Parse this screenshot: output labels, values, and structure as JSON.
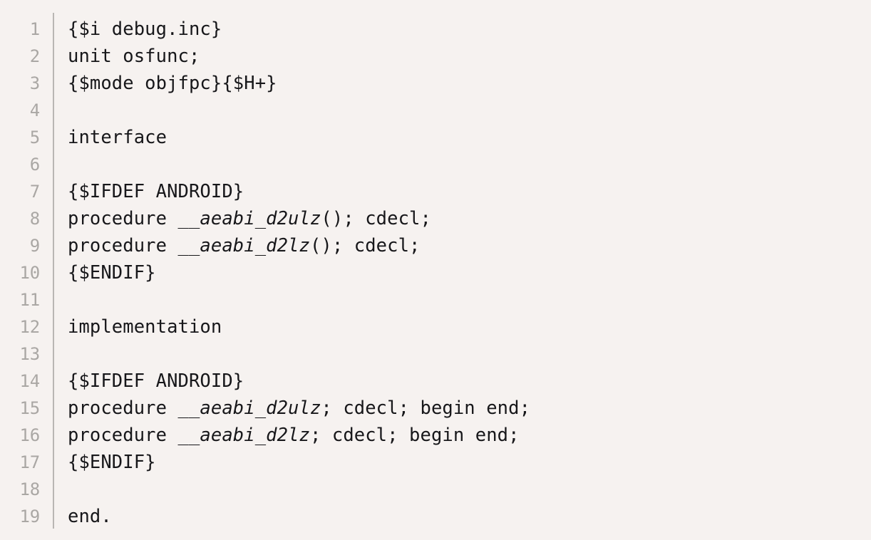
{
  "editor": {
    "name": "code-viewer",
    "language": "Pascal",
    "background_color": "#f6f2f0",
    "code_color": "#17171a",
    "line_number_color": "#aaa7a4",
    "divider_color": "#b9b6b3",
    "total_lines": 19
  },
  "lines": [
    {
      "number": "1",
      "text": "{$i debug.inc}",
      "tokens": [
        {
          "t": "{$i debug.inc}",
          "style": "plain"
        }
      ]
    },
    {
      "number": "2",
      "text": "unit osfunc;",
      "tokens": [
        {
          "t": "unit osfunc;",
          "style": "plain"
        }
      ]
    },
    {
      "number": "3",
      "text": "{$mode objfpc}{$H+}",
      "tokens": [
        {
          "t": "{$mode objfpc}{$H+}",
          "style": "plain"
        }
      ]
    },
    {
      "number": "4",
      "text": "",
      "tokens": []
    },
    {
      "number": "5",
      "text": "interface",
      "tokens": [
        {
          "t": "interface",
          "style": "plain"
        }
      ]
    },
    {
      "number": "6",
      "text": "",
      "tokens": []
    },
    {
      "number": "7",
      "text": "{$IFDEF ANDROID}",
      "tokens": [
        {
          "t": "{$IFDEF ANDROID}",
          "style": "plain"
        }
      ]
    },
    {
      "number": "8",
      "text": "procedure __aeabi_d2ulz(); cdecl;",
      "tokens": [
        {
          "t": "procedure ",
          "style": "plain"
        },
        {
          "t": "__aeabi_d2ulz",
          "style": "ident"
        },
        {
          "t": "(); cdecl;",
          "style": "plain"
        }
      ]
    },
    {
      "number": "9",
      "text": "procedure __aeabi_d2lz(); cdecl;",
      "tokens": [
        {
          "t": "procedure ",
          "style": "plain"
        },
        {
          "t": "__aeabi_d2lz",
          "style": "ident"
        },
        {
          "t": "(); cdecl;",
          "style": "plain"
        }
      ]
    },
    {
      "number": "10",
      "text": "{$ENDIF}",
      "tokens": [
        {
          "t": "{$ENDIF}",
          "style": "plain"
        }
      ]
    },
    {
      "number": "11",
      "text": "",
      "tokens": []
    },
    {
      "number": "12",
      "text": "implementation",
      "tokens": [
        {
          "t": "implementation",
          "style": "plain"
        }
      ]
    },
    {
      "number": "13",
      "text": "",
      "tokens": []
    },
    {
      "number": "14",
      "text": "{$IFDEF ANDROID}",
      "tokens": [
        {
          "t": "{$IFDEF ANDROID}",
          "style": "plain"
        }
      ]
    },
    {
      "number": "15",
      "text": "procedure __aeabi_d2ulz; cdecl; begin end;",
      "tokens": [
        {
          "t": "procedure ",
          "style": "plain"
        },
        {
          "t": "__aeabi_d2ulz",
          "style": "ident"
        },
        {
          "t": "; cdecl; begin end;",
          "style": "plain"
        }
      ]
    },
    {
      "number": "16",
      "text": "procedure __aeabi_d2lz; cdecl; begin end;",
      "tokens": [
        {
          "t": "procedure ",
          "style": "plain"
        },
        {
          "t": "__aeabi_d2lz",
          "style": "ident"
        },
        {
          "t": "; cdecl; begin end;",
          "style": "plain"
        }
      ]
    },
    {
      "number": "17",
      "text": "{$ENDIF}",
      "tokens": [
        {
          "t": "{$ENDIF}",
          "style": "plain"
        }
      ]
    },
    {
      "number": "18",
      "text": "",
      "tokens": []
    },
    {
      "number": "19",
      "text": "end.",
      "tokens": [
        {
          "t": "end.",
          "style": "plain"
        }
      ]
    }
  ]
}
